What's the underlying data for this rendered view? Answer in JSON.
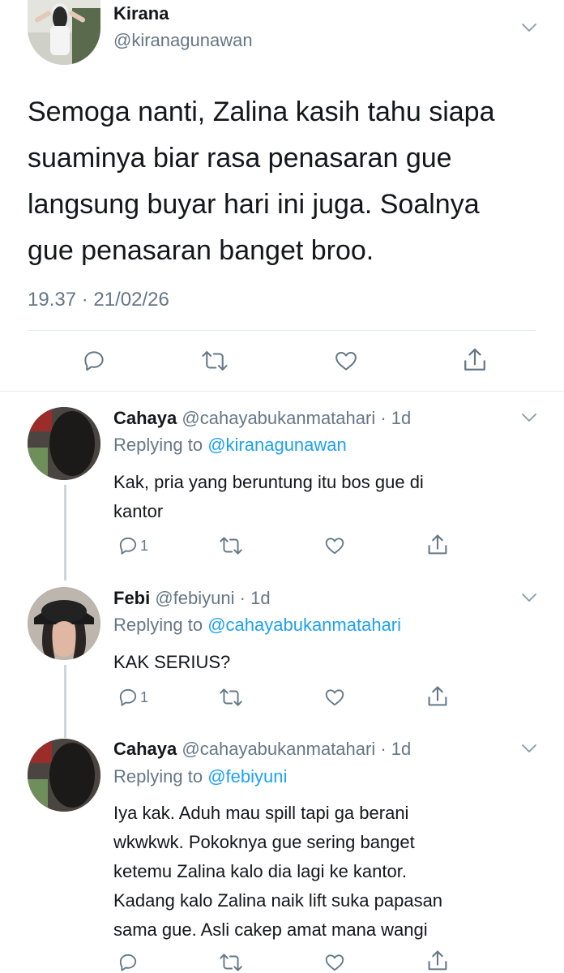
{
  "main_tweet": {
    "display_name": "Kirana",
    "handle": "@kiranagunawan",
    "text_lines": [
      "Semoga nanti, Zalina kasih tahu siapa",
      "suaminya biar rasa penasaran gue",
      "langsung buyar hari ini juga. Soalnya",
      "gue penasaran banget broo."
    ],
    "timestamp": "19.37 · 21/02/26"
  },
  "replies": [
    {
      "display_name": "Cahaya",
      "handle": "@cahayabukanmatahari",
      "time": "· 1d",
      "replying_label": "Replying to",
      "replying_to": "@kiranagunawan",
      "text_lines": [
        "Kak, pria yang beruntung itu bos gue di",
        "kantor"
      ],
      "reply_count": "1"
    },
    {
      "display_name": "Febi",
      "handle": "@febiyuni",
      "time": "· 1d",
      "replying_label": "Replying to",
      "replying_to": "@cahayabukanmatahari",
      "text_lines": [
        "KAK SERIUS?"
      ],
      "reply_count": "1"
    },
    {
      "display_name": "Cahaya",
      "handle": "@cahayabukanmatahari",
      "time": "· 1d",
      "replying_label": "Replying to",
      "replying_to": "@febiyuni",
      "text_lines": [
        "Iya kak. Aduh mau spill tapi ga berani",
        "wkwkwk. Pokoknya gue sering banget",
        "ketemu Zalina kalo dia lagi ke kantor.",
        "Kadang kalo Zalina naik lift suka papasan",
        "sama gue. Asli cakep amat mana wangi"
      ],
      "reply_count": ""
    }
  ],
  "icons": {
    "reply": "reply-icon",
    "retweet": "retweet-icon",
    "like": "like-icon",
    "share": "share-icon",
    "more": "chevron-down-icon"
  },
  "colors": {
    "text": "#14171a",
    "secondary": "#657786",
    "link": "#1da1f2",
    "divider": "#e6ecf0",
    "thread_line": "#ccd6dd"
  }
}
